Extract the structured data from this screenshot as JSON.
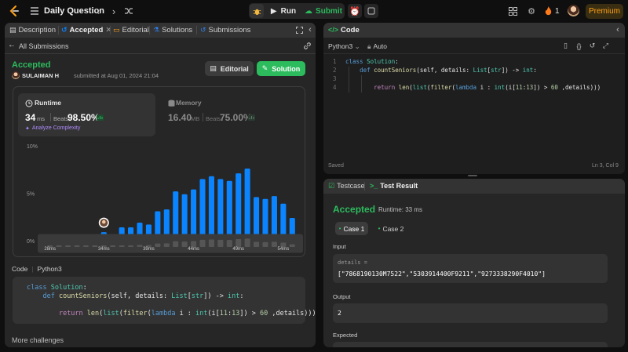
{
  "topbar": {
    "title": "Daily Question",
    "run_label": "Run",
    "submit_label": "Submit",
    "streak": "1",
    "premium_label": "Premium",
    "icons": [
      "leetcode-logo-icon",
      "problem-list-icon",
      "prev-icon",
      "next-icon",
      "shuffle-icon",
      "debug-icon",
      "play-icon",
      "upload-icon",
      "alarm-icon",
      "notes-icon",
      "layout-icon",
      "gear-icon",
      "fire-icon"
    ]
  },
  "left": {
    "tabs": {
      "description": "Description",
      "accepted": "Accepted",
      "editorial": "Editorial",
      "solutions": "Solutions",
      "submissions": "Submissions"
    },
    "all_submissions": "All Submissions",
    "status": "Accepted",
    "user": "SULAIMAN H",
    "submitted_at": "submitted at Aug 01, 2024 21:04",
    "editorial_btn": "Editorial",
    "solution_btn": "Solution",
    "runtime": {
      "label": "Runtime",
      "value": "34",
      "unit": "ms",
      "beats_label": "Beats",
      "beats": "98.50%",
      "analyze": "Analyze Complexity"
    },
    "memory": {
      "label": "Memory",
      "value": "16.40",
      "unit": "MB",
      "beats_label": "Beats",
      "beats": "75.00%"
    },
    "code_label": "Code",
    "code_lang": "Python3",
    "code_lines": [
      "class Solution:",
      "    def countSeniors(self, details: List[str]) -> int:",
      "",
      "        return len(list(filter(lambda i : int(i[11:13]) > 60 ,details)))"
    ],
    "more": "More challenges"
  },
  "chart_data": {
    "type": "bar",
    "ylabel": "",
    "xlabel": "",
    "y_ticks": [
      "10%",
      "5%",
      "0%"
    ],
    "ylim": [
      0,
      10
    ],
    "x_ticks": [
      "28ms",
      "34ms",
      "39ms",
      "44ms",
      "49ms",
      "54ms"
    ],
    "x": [
      28,
      29,
      30,
      31,
      32,
      33,
      34,
      35,
      36,
      37,
      38,
      39,
      40,
      41,
      42,
      43,
      44,
      45,
      46,
      47,
      48,
      49,
      50,
      51,
      52,
      53,
      54,
      55
    ],
    "values": [
      0.3,
      0.3,
      0.3,
      0.3,
      0.3,
      0.5,
      0.9,
      0.3,
      1.4,
      1.4,
      1.9,
      1.7,
      3.1,
      3.3,
      5.2,
      4.9,
      5.4,
      6.5,
      6.8,
      6.5,
      6.3,
      7.1,
      7.6,
      4.6,
      4.4,
      4.7,
      3.9,
      2.4
    ],
    "highlight_x": 34,
    "overview": {
      "x_ticks": [
        "28ms",
        "34ms",
        "39ms",
        "44ms",
        "49ms",
        "54ms"
      ]
    },
    "colors": {
      "bar": "#0a84ff",
      "overview_bar": "#555555"
    }
  },
  "editor": {
    "title": "Code",
    "lang": "Python3",
    "auto": "Auto",
    "lines": [
      {
        "n": "1",
        "code": "class Solution:"
      },
      {
        "n": "2",
        "code": "    def countSeniors(self, details: List[str]) -> int:"
      },
      {
        "n": "3",
        "code": ""
      },
      {
        "n": "4",
        "code": "        return len(list(filter(lambda i : int(i[11:13]) > 60 ,details)))"
      }
    ],
    "saved": "Saved",
    "cursor": "Ln 3, Col 9"
  },
  "result": {
    "testcase_tab": "Testcase",
    "result_tab": "Test Result",
    "status": "Accepted",
    "runtime": "Runtime: 33 ms",
    "case1": "Case 1",
    "case2": "Case 2",
    "input_label": "Input",
    "input_name": "details =",
    "input_value": "[\"7868190130M7522\",\"5303914400F9211\",\"9273338290F4010\"]",
    "output_label": "Output",
    "output_value": "2",
    "expected_label": "Expected"
  },
  "colors": {
    "accent_green": "#2cbb5d",
    "brand_orange": "#ffa116",
    "bar_blue": "#0a84ff"
  }
}
